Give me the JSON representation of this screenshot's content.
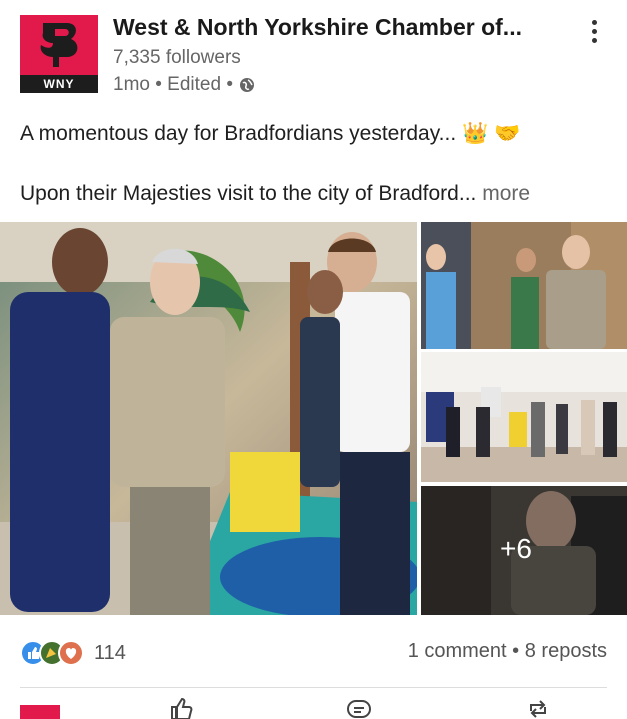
{
  "post": {
    "author": "West & North Yorkshire Chamber of...",
    "logo_text": "WNY",
    "followers": "7,335 followers",
    "meta": "1mo • Edited •",
    "line1": "A momentous day for Bradfordians yesterday... 👑 🤝",
    "line2": "Upon their Majesties visit to the city of Bradford...",
    "more": " more",
    "extra_photos": "+6",
    "reaction_count": "114",
    "comments_reposts": "1 comment • 8 reposts"
  },
  "colors": {
    "brand": "#e2194b",
    "like": "#378fe9",
    "celebrate": "#44712e",
    "love": "#df704d"
  },
  "icons": [
    "more-vert-icon",
    "globe-icon",
    "like-reaction-icon",
    "celebrate-reaction-icon",
    "love-reaction-icon",
    "like-action-icon",
    "comment-action-icon",
    "repost-action-icon"
  ]
}
